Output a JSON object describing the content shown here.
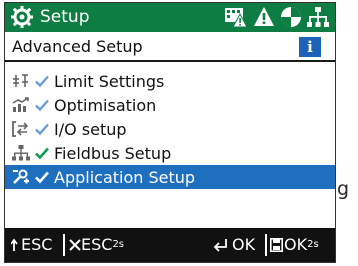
{
  "header": {
    "title": "Setup",
    "icons": [
      "gear-icon",
      "keyboard-warning-icon",
      "warning-triangle-icon",
      "maintenance-icon",
      "fieldbus-icon"
    ]
  },
  "subheader": {
    "title": "Advanced Setup",
    "info_glyph": "i"
  },
  "menu": {
    "items": [
      {
        "label": "Limit Settings",
        "icon": "limit-settings-icon",
        "check_color": "#6a9fd4",
        "selected": false
      },
      {
        "label": "Optimisation",
        "icon": "optimisation-icon",
        "check_color": "#6a9fd4",
        "selected": false
      },
      {
        "label": "I/O setup",
        "icon": "io-setup-icon",
        "check_color": "#6a9fd4",
        "selected": false
      },
      {
        "label": "Fieldbus Setup",
        "icon": "fieldbus-setup-icon",
        "check_color": "#0d9a52",
        "selected": false
      },
      {
        "label": "Application Setup",
        "icon": "application-setup-icon",
        "check_color": "#ffffff",
        "selected": true
      }
    ]
  },
  "footer": {
    "esc": "ESC",
    "esc_hold": "ESC",
    "hold_sub": "2s",
    "ok": "OK",
    "ok_hold": "OK",
    "ok_hold_sub": "2s"
  },
  "overflow_text": "g",
  "colors": {
    "header": "#0d7d43",
    "selected": "#1f6fc1",
    "info": "#1c63b7",
    "footer": "#111111"
  }
}
